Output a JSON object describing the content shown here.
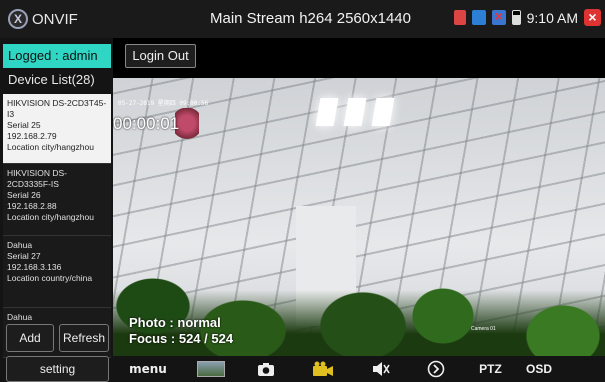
{
  "app": {
    "logo_letter": "X",
    "title": "ONVIF",
    "stream_title": "Main Stream h264 2560x1440"
  },
  "status": {
    "time": "9:10 AM",
    "icons": [
      "sd-card-icon",
      "document-icon",
      "network-off-icon",
      "battery-icon",
      "close-icon"
    ]
  },
  "sidebar": {
    "logged_label": "Logged : admin",
    "device_list_label": "Device List(28)",
    "devices": [
      {
        "name": "HIKVISION DS-2CD3T45-I3",
        "serial": "Serial 25",
        "ip": "192.168.2.79",
        "location": "Location city/hangzhou",
        "selected": true
      },
      {
        "name": "HIKVISION DS-2CD3335F-IS",
        "serial": "Serial 26",
        "ip": "192.168.2.88",
        "location": "Location city/hangzhou",
        "selected": false
      },
      {
        "name": "Dahua",
        "serial": "Serial 27",
        "ip": "192.168.3.136",
        "location": "Location country/china",
        "selected": false
      },
      {
        "name": "Dahua",
        "serial": "",
        "ip": "",
        "location": "",
        "selected": false
      }
    ],
    "add_label": "Add",
    "refresh_label": "Refresh",
    "setting_label": "setting"
  },
  "main": {
    "login_out_label": "Login Out",
    "video": {
      "camera_timestamp": "05-27-2019 星期四 09:00:56",
      "elapsed": "00:00:01",
      "photo_mode": "Photo : normal",
      "focus": "Focus : 524 / 524",
      "camera_name_overlay": "Camera 01"
    }
  },
  "toolbar": {
    "menu_label": "menu",
    "ptz_label": "PTZ",
    "osd_label": "OSD"
  },
  "colors": {
    "accent": "#2fd6c3",
    "rec_icon": "#e0c020"
  }
}
